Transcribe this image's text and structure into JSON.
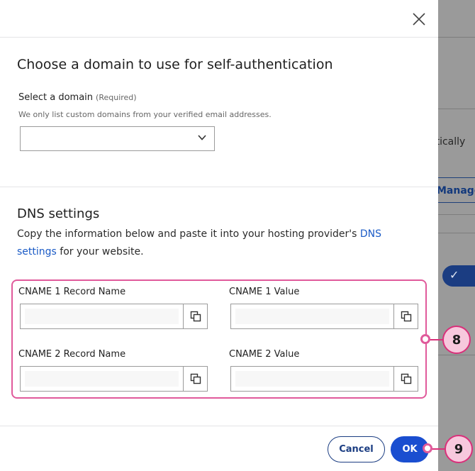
{
  "background": {
    "partial_text": "atically",
    "manage_label": "Manage",
    "toggle_check": "✓"
  },
  "modal": {
    "close_icon": "close-icon",
    "domain_section": {
      "title": "Choose a domain to use for self-authentication",
      "select_label": "Select a domain",
      "required_tag": "(Required)",
      "hint": "We only list custom domains from your verified email addresses.",
      "selected_value": ""
    },
    "dns_section": {
      "title": "DNS settings",
      "description_before": "Copy the information below and paste it into your hosting provider's ",
      "link_text": "DNS settings",
      "description_after": " for your website.",
      "fields": {
        "cname1_name_label": "CNAME 1 Record Name",
        "cname1_value_label": "CNAME 1 Value",
        "cname2_name_label": "CNAME 2 Record Name",
        "cname2_value_label": "CNAME 2 Value"
      }
    },
    "footer": {
      "cancel_label": "Cancel",
      "ok_label": "OK"
    }
  },
  "callouts": {
    "fields_marker": "8",
    "ok_marker": "9"
  },
  "colors": {
    "primary": "#1a4ed0",
    "link": "#1b5bc6",
    "callout_border": "#d9307a",
    "highlight": "#e05a9b"
  }
}
